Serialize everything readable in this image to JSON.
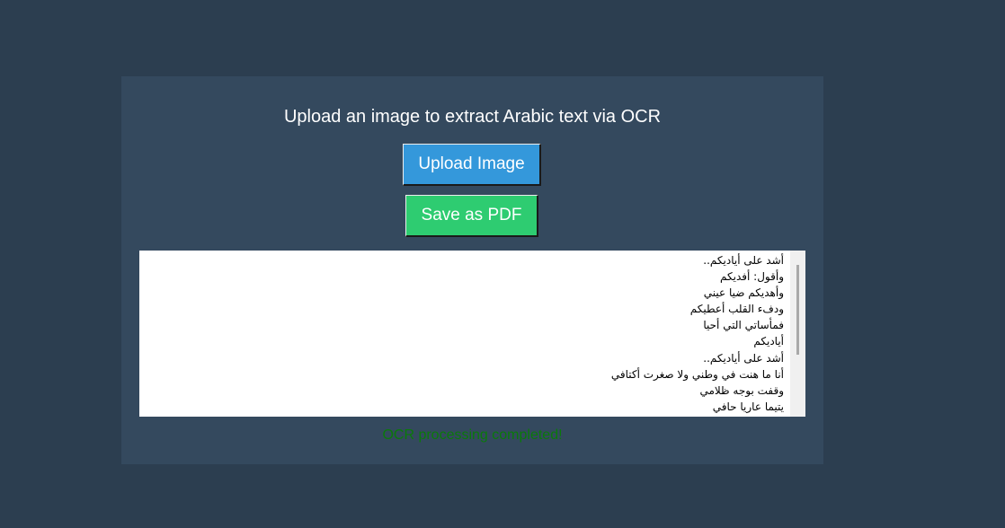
{
  "app": {
    "title": "Upload an image to extract Arabic text via OCR"
  },
  "buttons": {
    "upload_label": "Upload Image",
    "save_pdf_label": "Save as PDF"
  },
  "ocr_output": {
    "lines": [
      "أشد على أياديكم..",
      "وأقول: أفديكم",
      "وأهديكم ضيا عيني",
      "ودفء القلب أعطيكم",
      "فمأساتي التي أحيا",
      "أياديكم",
      "أشد على أياديكم..",
      "أنا ما هنت في وطني ولا صغرت أكتافي",
      "وقفت بوجه ظلامي",
      "يتيما عاريا حافي"
    ]
  },
  "status": {
    "message": "OCR processing completed!"
  },
  "colors": {
    "page_background": "#2c3e50",
    "panel_background": "#34495e",
    "upload_button": "#3498db",
    "save_pdf_button": "#2ecc71",
    "status_text": "#0a7a0a"
  }
}
